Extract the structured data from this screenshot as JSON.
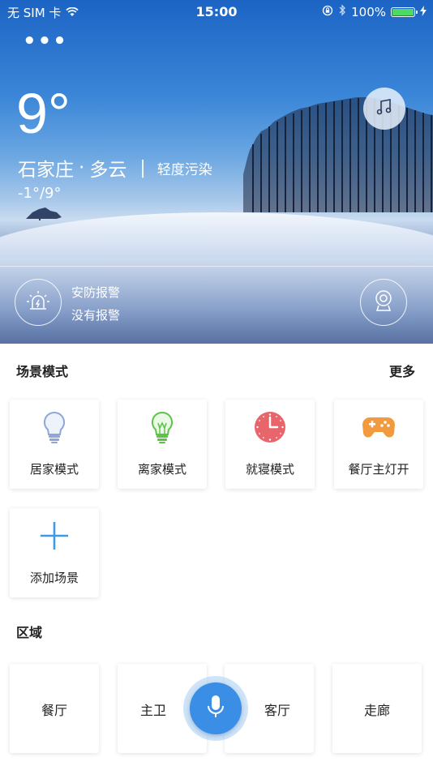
{
  "status_bar": {
    "carrier": "无 SIM 卡",
    "time": "15:00",
    "battery": "100%",
    "battery_level": 1.0,
    "icons": [
      "wifi-icon",
      "rotation-lock-icon",
      "bluetooth-icon",
      "battery-icon",
      "charging-icon"
    ]
  },
  "hero": {
    "more_label": "•••",
    "temperature": "9°",
    "city": "石家庄",
    "weather": "多云",
    "separator": "·",
    "divider": "|",
    "air_quality": "轻度污染",
    "temp_range": "-1°/9°",
    "alarm_title": "安防报警",
    "alarm_status": "没有报警",
    "icons": {
      "music": "music-note-icon",
      "alarm": "siren-icon",
      "camera": "webcam-icon"
    }
  },
  "scenes": {
    "title": "场景模式",
    "more": "更多",
    "items": [
      {
        "label": "居家模式",
        "icon": "lightbulb-icon",
        "color": "#8fa6d8"
      },
      {
        "label": "离家模式",
        "icon": "lightbulb-on-icon",
        "color": "#5cc349"
      },
      {
        "label": "就寝模式",
        "icon": "clock-icon",
        "color": "#e8656b"
      },
      {
        "label": "餐厅主灯开",
        "icon": "gamepad-icon",
        "color": "#f19a3e"
      }
    ],
    "add": {
      "label": "添加场景",
      "icon": "plus-icon",
      "color": "#3c9be8"
    }
  },
  "regions": {
    "title": "区域",
    "items": [
      {
        "label": "餐厅"
      },
      {
        "label": "主卫"
      },
      {
        "label": "客厅"
      },
      {
        "label": "走廊"
      }
    ]
  },
  "voice": {
    "icon": "microphone-icon",
    "color": "#3a8ee6"
  }
}
